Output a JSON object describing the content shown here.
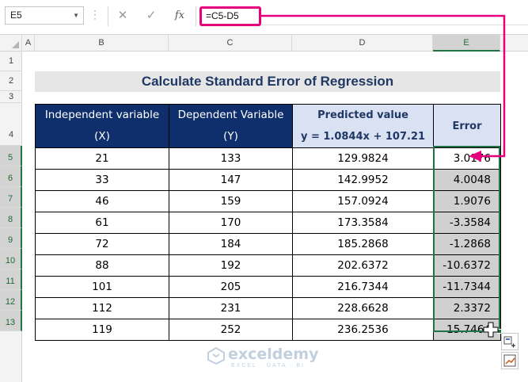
{
  "formula_bar": {
    "name_box": "E5",
    "cancel_glyph": "✕",
    "enter_glyph": "✓",
    "fx_label": "fx",
    "formula": "=C5-D5"
  },
  "columns": [
    "A",
    "B",
    "C",
    "D",
    "E"
  ],
  "rows": [
    "1",
    "2",
    "3",
    "4",
    "5",
    "6",
    "7",
    "8",
    "9",
    "10",
    "11",
    "12",
    "13"
  ],
  "title": "Calculate Standard Error of Regression",
  "table": {
    "headers": {
      "independent": {
        "line1": "Independent variable",
        "line2": "(X)"
      },
      "dependent": {
        "line1": "Dependent Variable",
        "line2": "(Y)"
      },
      "predicted": {
        "line1": "Predicted value",
        "line2": "y = 1.0844x + 107.21"
      },
      "error": {
        "line1": "Error"
      }
    },
    "rows": [
      [
        "21",
        "133",
        "129.9824",
        "3.0176"
      ],
      [
        "33",
        "147",
        "142.9952",
        "4.0048"
      ],
      [
        "46",
        "159",
        "157.0924",
        "1.9076"
      ],
      [
        "61",
        "170",
        "173.3584",
        "-3.3584"
      ],
      [
        "72",
        "184",
        "185.2868",
        "-1.2868"
      ],
      [
        "88",
        "192",
        "202.6372",
        "-10.6372"
      ],
      [
        "101",
        "205",
        "216.7344",
        "-11.7344"
      ],
      [
        "112",
        "231",
        "228.6628",
        "2.3372"
      ],
      [
        "119",
        "252",
        "236.2536",
        "15.7464"
      ]
    ]
  },
  "watermark": {
    "name": "exceldemy",
    "tagline": "EXCEL · DATA · BI"
  },
  "colors": {
    "accent": "#e6007e",
    "header_dark": "#0e2f6b",
    "header_light": "#d9e1f2",
    "selection": "#217346"
  }
}
